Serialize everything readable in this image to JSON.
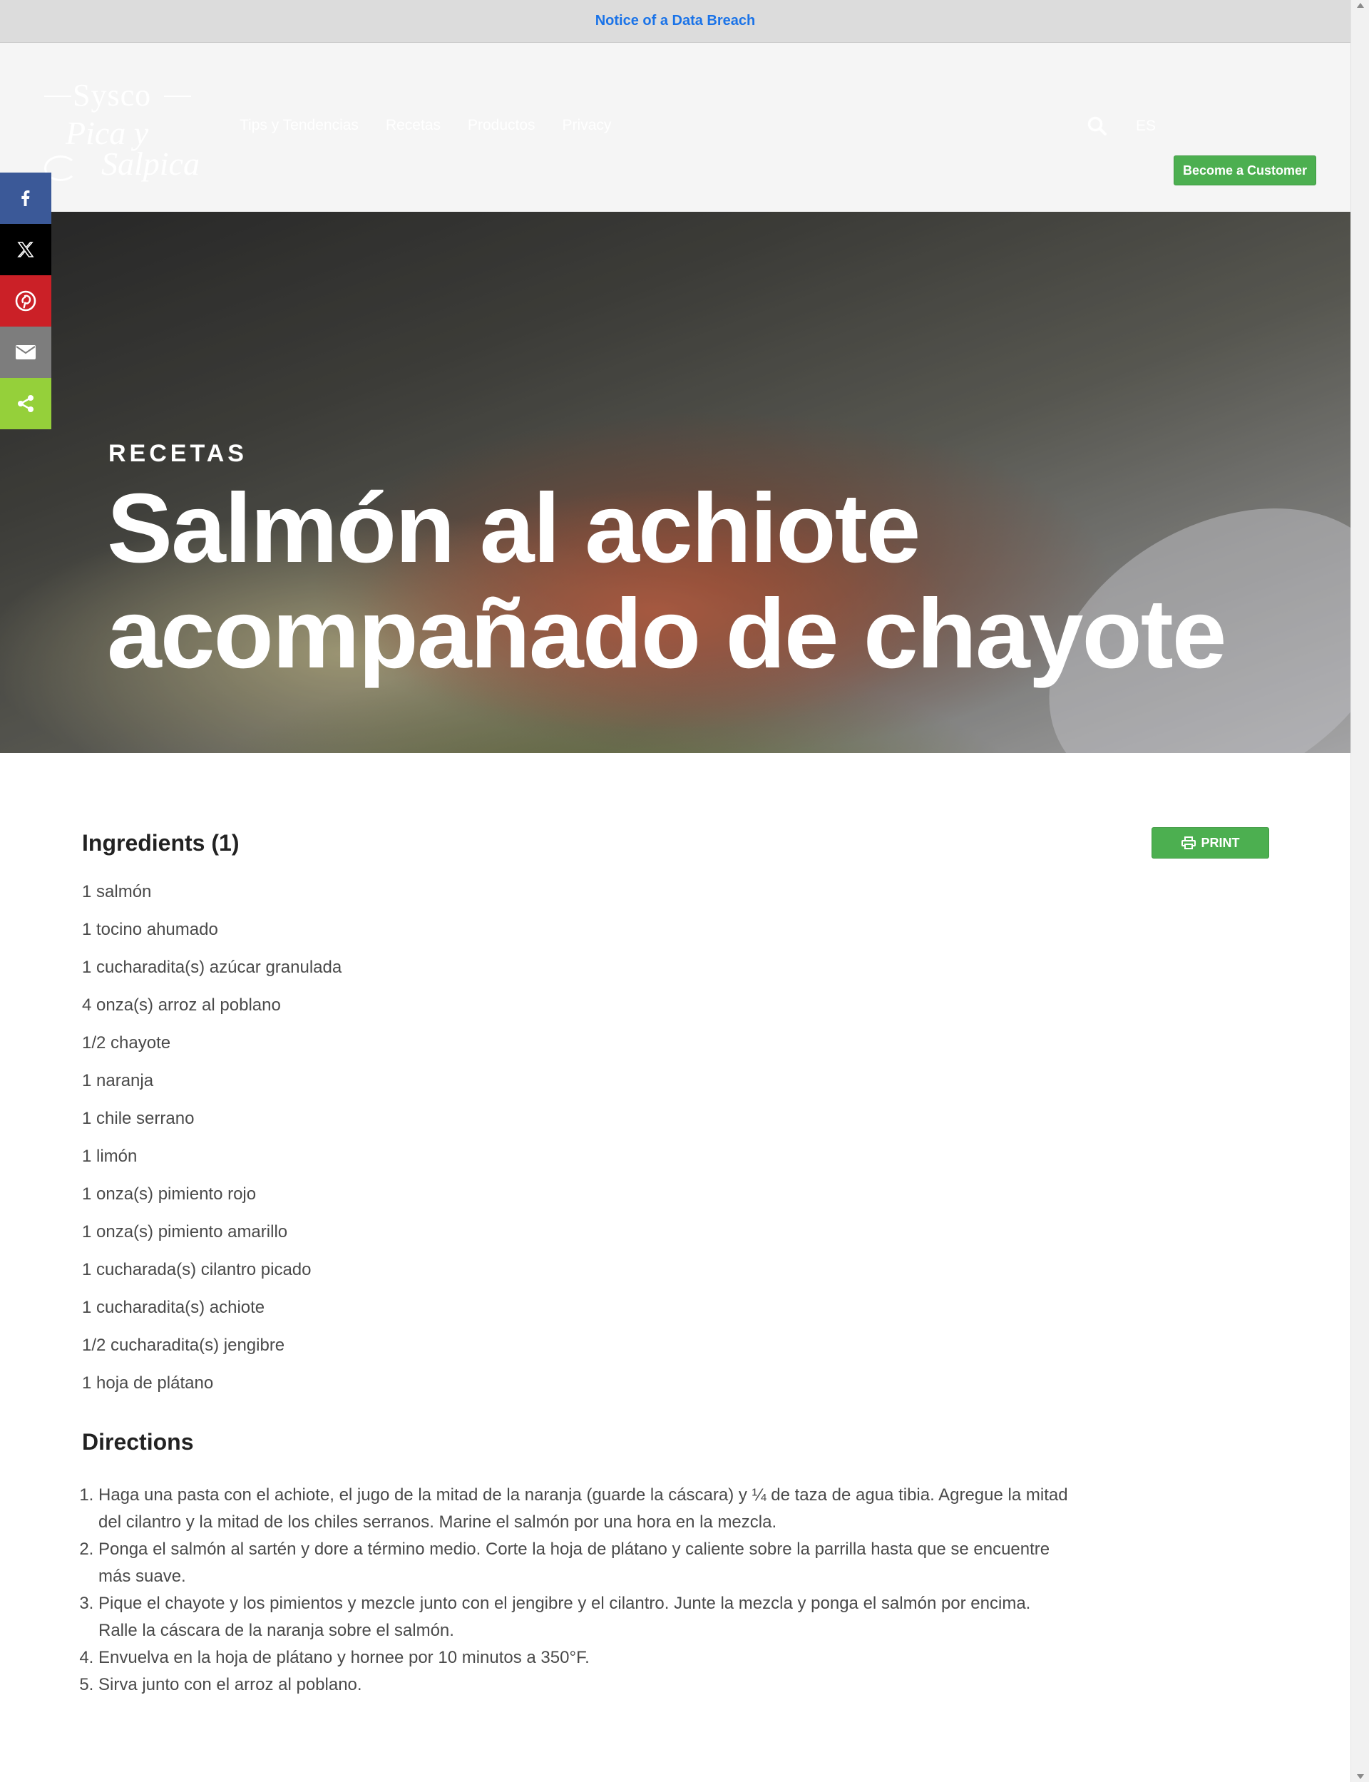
{
  "notice": {
    "label": "Notice of a Data Breach"
  },
  "header": {
    "logo": {
      "line1": "Sysco",
      "line2": "Pica y",
      "line3": "Salpica"
    },
    "nav": [
      "Tips y Tendencias",
      "Recetas",
      "Productos",
      "Privacy"
    ],
    "search_icon": "search-icon",
    "language": "ES",
    "cta_label": "Become a Customer",
    "cta_color": "#4caf50"
  },
  "social": {
    "items": [
      {
        "name": "facebook",
        "icon": "facebook-icon",
        "color": "#3b5998"
      },
      {
        "name": "x",
        "icon": "x-icon",
        "color": "#000000"
      },
      {
        "name": "pinterest",
        "icon": "pinterest-icon",
        "color": "#cb2027"
      },
      {
        "name": "email",
        "icon": "mail-icon",
        "color": "#7d7d7d"
      },
      {
        "name": "share",
        "icon": "share-icon",
        "color": "#95d03a"
      }
    ]
  },
  "hero": {
    "category": "RECETAS",
    "title_line1": "Salmón al achiote",
    "title_line2": "acompañado de chayote"
  },
  "recipe": {
    "print_label": "PRINT",
    "ingredients_heading": "Ingredients (1)",
    "ingredients": [
      "1 salmón",
      "1 tocino ahumado",
      "1 cucharadita(s) azúcar granulada",
      "4 onza(s) arroz al poblano",
      "1/2 chayote",
      "1 naranja",
      "1 chile serrano",
      "1 limón",
      "1 onza(s) pimiento rojo",
      "1 onza(s) pimiento amarillo",
      "1 cucharada(s) cilantro picado",
      "1 cucharadita(s) achiote",
      "1/2 cucharadita(s) jengibre",
      "1 hoja de plátano"
    ],
    "directions_heading": "Directions",
    "directions": [
      "Haga una pasta con el achiote, el jugo de la mitad de la naranja (guarde la cáscara) y ¼ de taza de agua tibia. Agregue la mitad del cilantro y la mitad de los chiles serranos. Marine el salmón por una hora en la mezcla.",
      "Ponga el salmón al sartén y dore a término medio. Corte la hoja de plátano y caliente sobre la parrilla hasta que se encuentre más suave.",
      "Pique el chayote y los pimientos y mezcle junto con el jengibre y el cilantro. Junte la mezcla y ponga el salmón por encima. Ralle la cáscara de la naranja sobre el salmón.",
      "Envuelva en la hoja de plátano y hornee por 10 minutos a 350°F.",
      "Sirva junto con el arroz al poblano."
    ]
  }
}
